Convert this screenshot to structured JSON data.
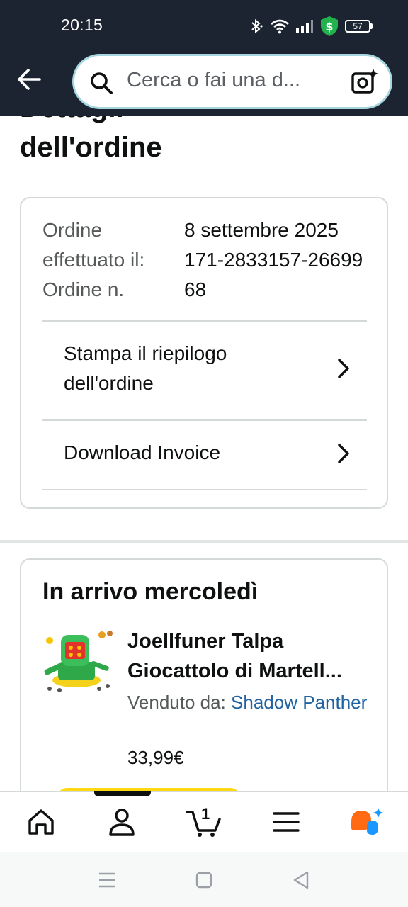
{
  "status_bar": {
    "time": "20:15",
    "battery": "57"
  },
  "header": {
    "search_placeholder": "Cerca o fai una d..."
  },
  "page": {
    "title_line1": "Dettagli",
    "title_line2": "dell'ordine"
  },
  "order_info": {
    "placed_label": "Ordine effettuato il:",
    "placed_value": "8 settembre 2025",
    "number_label": "Ordine n.",
    "number_value": "171-2833157-2669968"
  },
  "links": {
    "print_summary": "Stampa il riepilogo dell'ordine",
    "download_invoice": "Download Invoice"
  },
  "shipment": {
    "arrival": "In arrivo mercoledì",
    "product_title_line1": "Joellfuner Talpa",
    "product_title_line2": "Giocattolo di Martell...",
    "seller_label": "Venduto da:",
    "seller_name": "Shadow Panther",
    "price": "33,99€"
  },
  "bottom_nav": {
    "cart_count": "1"
  },
  "colors": {
    "header_bg": "#1b2430",
    "link": "#2162a1",
    "button_yellow": "#ffd814",
    "assistant_orange": "#ff6a13",
    "assistant_blue": "#1a98ff"
  }
}
